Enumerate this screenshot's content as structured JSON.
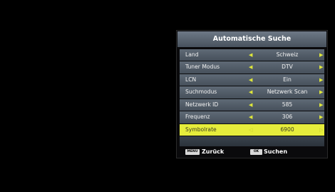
{
  "dialog": {
    "title": "Automatische Suche"
  },
  "rows": [
    {
      "label": "Land",
      "value": "Schweiz"
    },
    {
      "label": "Tuner Modus",
      "value": "DTV"
    },
    {
      "label": "LCN",
      "value": "Ein"
    },
    {
      "label": "Suchmodus",
      "value": "Netzwerk Scan"
    },
    {
      "label": "Netzwerk ID",
      "value": "585"
    },
    {
      "label": "Frequenz",
      "value": "306"
    },
    {
      "label": "Symbolrate",
      "value": "6900"
    }
  ],
  "icons": {
    "left": "◀",
    "right": "▶",
    "left_outline": "◁",
    "right_outline": "▷"
  },
  "footer": {
    "back_key": "MENU",
    "back_label": "Zurück",
    "search_key": "OK",
    "search_label": "Suchen"
  },
  "colors": {
    "highlight": "#e6ed3c",
    "arrow": "#e0e83a"
  }
}
